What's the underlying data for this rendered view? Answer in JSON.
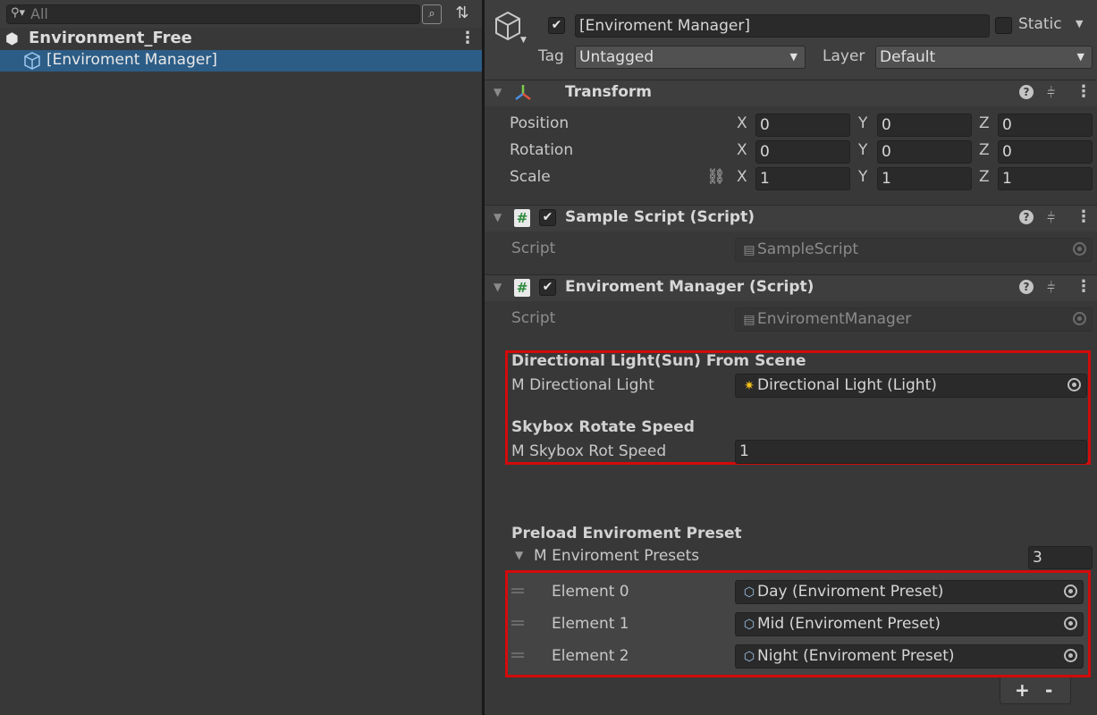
{
  "hierarchy": {
    "search_placeholder": "All",
    "scene_name": "Environment_Free",
    "selected_object": "[Enviroment Manager]"
  },
  "inspector": {
    "object_name": "[Enviroment Manager]",
    "static_label": "Static",
    "tag_label": "Tag",
    "tag_value": "Untagged",
    "layer_label": "Layer",
    "layer_value": "Default",
    "transform": {
      "title": "Transform",
      "rows": [
        {
          "label": "Position",
          "x": "0",
          "y": "0",
          "z": "0"
        },
        {
          "label": "Rotation",
          "x": "0",
          "y": "0",
          "z": "0"
        },
        {
          "label": "Scale",
          "x": "1",
          "y": "1",
          "z": "1"
        }
      ],
      "axis_x": "X",
      "axis_y": "Y",
      "axis_z": "Z"
    },
    "sample_script": {
      "title": "Sample Script (Script)",
      "script_label": "Script",
      "script_value": "SampleScript"
    },
    "env_manager": {
      "title": "Enviroment Manager (Script)",
      "script_label": "Script",
      "script_value": "EnviromentManager",
      "sun_header": "Directional Light(Sun) From Scene",
      "light_label": "M Directional Light",
      "light_value": "Directional Light (Light)",
      "skybox_header": "Skybox Rotate Speed",
      "skybox_label": "M Skybox Rot Speed",
      "skybox_value": "1",
      "preload_header": "Preload Enviroment Preset",
      "presets_label": "M Enviroment Presets",
      "presets_count": "3",
      "elements": [
        {
          "label": "Element 0",
          "value": "Day (Enviroment Preset)"
        },
        {
          "label": "Element 1",
          "value": "Mid (Enviroment Preset)"
        },
        {
          "label": "Element 2",
          "value": "Night (Enviroment Preset)"
        }
      ],
      "add_label": "+",
      "remove_label": "-"
    }
  },
  "colors": {
    "selection": "#2c5d87",
    "highlight_box": "#d20b0b",
    "panel_bg": "#383838"
  }
}
